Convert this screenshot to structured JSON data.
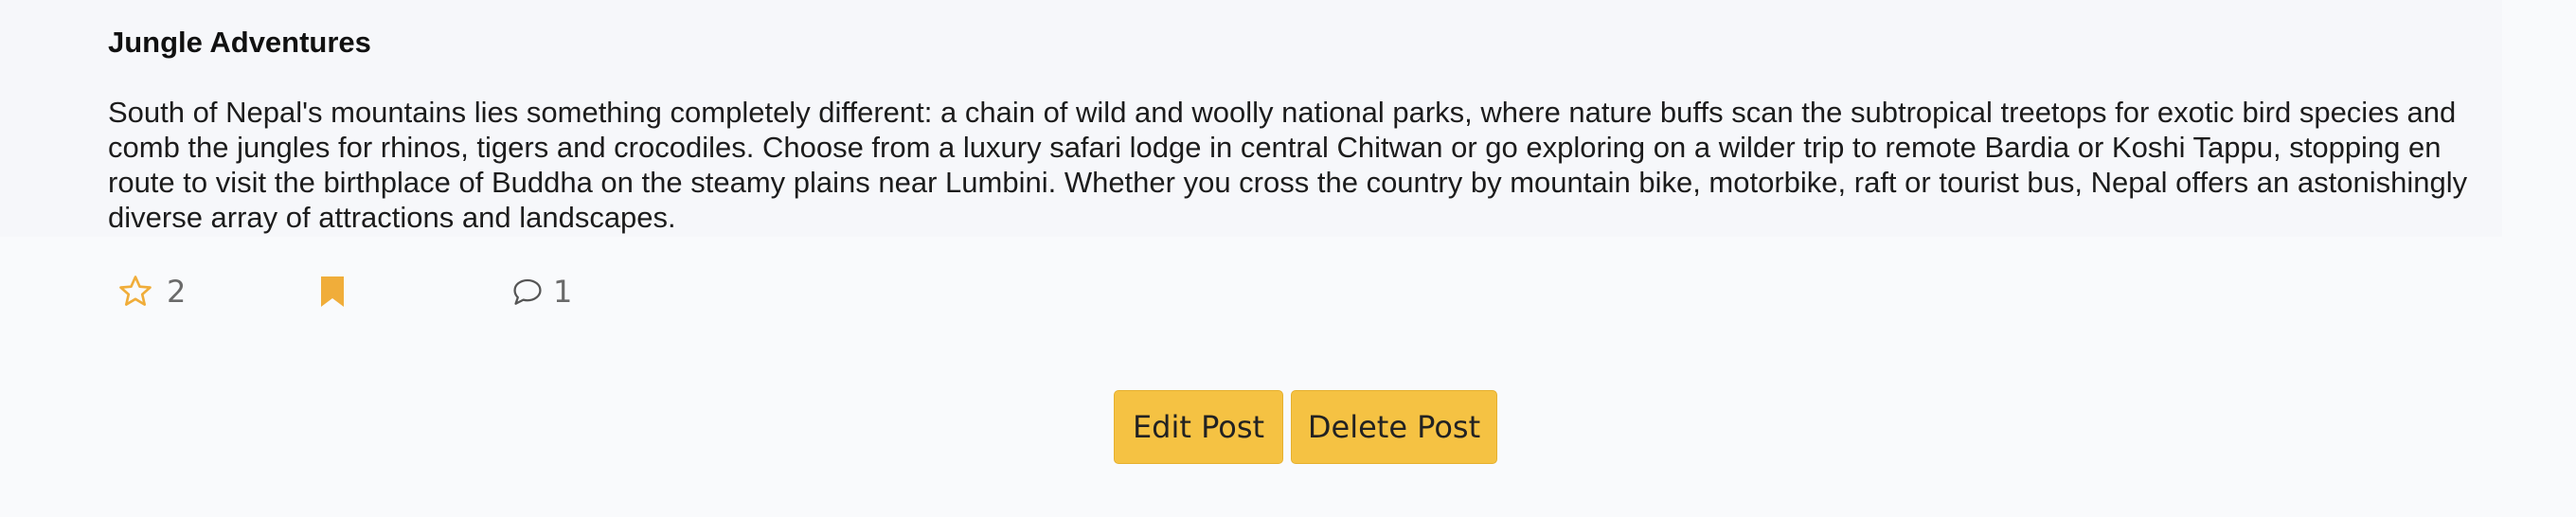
{
  "post": {
    "title": "Jungle Adventures",
    "body": "South of Nepal's mountains lies something completely different: a chain of wild and woolly national parks, where nature buffs scan the subtropical treetops for exotic bird species and comb the jungles for rhinos, tigers and crocodiles. Choose from a luxury safari lodge in central Chitwan or go exploring on a wilder trip to remote Bardia or Koshi Tappu, stopping en route to visit the birthplace of Buddha on the steamy plains near Lumbini. Whether you cross the country by mountain bike, motorbike, raft or tourist bus, Nepal offers an astonishingly diverse array of attractions and landscapes."
  },
  "actions": {
    "star": {
      "icon": "star-outline-icon",
      "count": "2",
      "color": "#f0ad3a"
    },
    "bookmark": {
      "icon": "bookmark-icon",
      "color": "#f0ad3a"
    },
    "comment": {
      "icon": "comment-icon",
      "count": "1",
      "color": "#555555"
    }
  },
  "buttons": {
    "edit_label": "Edit Post",
    "delete_label": "Delete Post",
    "color": "#f5c243"
  }
}
